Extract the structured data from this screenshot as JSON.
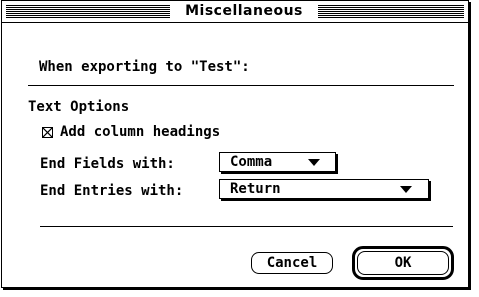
{
  "dialog": {
    "title": "Miscellaneous",
    "header": "When exporting to \"Test\":",
    "section_title": "Text Options",
    "checkbox": {
      "label": "Add column headings",
      "checked": true
    },
    "end_fields": {
      "label": "End Fields with:",
      "value": "Comma"
    },
    "end_entries": {
      "label": "End Entries with:",
      "value": "Return"
    },
    "buttons": {
      "cancel": "Cancel",
      "ok": "OK"
    }
  }
}
